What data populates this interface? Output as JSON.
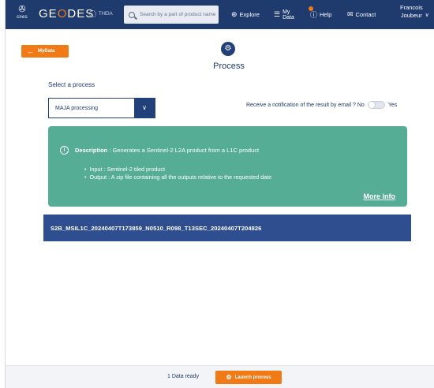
{
  "header": {
    "org_logo_text": "cnes",
    "app_name_pre": "GE",
    "app_name_o": "O",
    "app_name_post": "DES",
    "partner_logo_text": "THEIA",
    "search_placeholder": "Search by a part of product name",
    "nav": {
      "explore": "Explore",
      "mydata_line1": "My",
      "mydata_line2": "Data",
      "help": "Help",
      "contact": "Contact"
    },
    "user_first": "Francois",
    "user_last": "Joubeur"
  },
  "back_button": "MyData",
  "page_title": "Process",
  "process_section": {
    "label": "Select a process",
    "selected": "MAJA processing"
  },
  "notification": {
    "question": "Receive a notification of the result by email ?",
    "no": "No",
    "yes": "Yes"
  },
  "description": {
    "label": "Description",
    "text": " : Generates a Sentinel-2 L2A product from a L1C product",
    "items": [
      "Input : Sentinel-2 tiled product",
      "Output : A zip file containing all the outputs relative to the requested date"
    ],
    "more_info": "More info"
  },
  "product_name": "S2B_MSIL1C_20240407T173859_N0510_R098_T13SEC_20240407T204826",
  "footer": {
    "ready": "1 Data ready",
    "launch": "Launch process"
  },
  "colors": {
    "nav": "#1f3a6d",
    "accent": "#f07a16",
    "card": "#56ad96",
    "product": "#2f4e8f"
  }
}
